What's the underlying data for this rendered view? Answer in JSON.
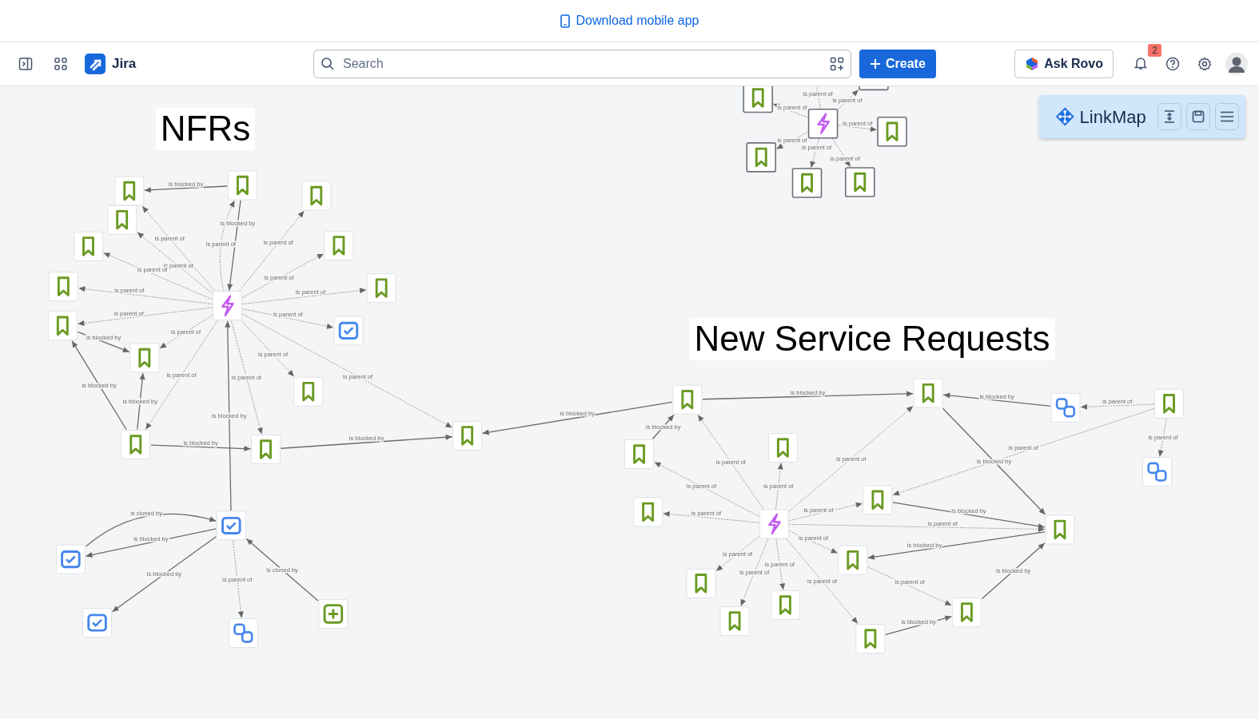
{
  "banner": {
    "text": "Download mobile app"
  },
  "topnav": {
    "app_name": "Jira",
    "search": {
      "placeholder": "Search"
    },
    "create_button": "Create",
    "rovo_button": "Ask Rovo",
    "notifications": "2"
  },
  "linkmap": {
    "title": "LinkMap"
  },
  "groups": [
    {
      "title": "NFRs"
    },
    {
      "title": "New Service Requests"
    }
  ],
  "nodes": [
    {
      "kind": "epic",
      "selected": false
    },
    {
      "kind": "story",
      "selected": false
    },
    {
      "kind": "story",
      "selected": false
    },
    {
      "kind": "story",
      "selected": false
    },
    {
      "kind": "story",
      "selected": false
    },
    {
      "kind": "story",
      "selected": false
    },
    {
      "kind": "story",
      "selected": false
    },
    {
      "kind": "story",
      "selected": false
    },
    {
      "kind": "story",
      "selected": false
    },
    {
      "kind": "story",
      "selected": false
    },
    {
      "kind": "story",
      "selected": false
    },
    {
      "kind": "story",
      "selected": false
    },
    {
      "kind": "story",
      "selected": false
    },
    {
      "kind": "task",
      "selected": false
    },
    {
      "kind": "story",
      "selected": false
    },
    {
      "kind": "story",
      "selected": false
    },
    {
      "kind": "task",
      "selected": false
    },
    {
      "kind": "task",
      "selected": false
    },
    {
      "kind": "task",
      "selected": false
    },
    {
      "kind": "subtask",
      "selected": false
    },
    {
      "kind": "feature",
      "selected": false
    },
    {
      "kind": "epic",
      "selected": true
    },
    {
      "kind": "story",
      "selected": true
    },
    {
      "kind": "story",
      "selected": true
    },
    {
      "kind": "story",
      "selected": true
    },
    {
      "kind": "story",
      "selected": true
    },
    {
      "kind": "story",
      "selected": true
    },
    {
      "kind": "story",
      "selected": true
    },
    {
      "kind": "epic",
      "selected": false
    },
    {
      "kind": "story",
      "selected": false
    },
    {
      "kind": "story",
      "selected": false
    },
    {
      "kind": "story",
      "selected": false
    },
    {
      "kind": "story",
      "selected": false
    },
    {
      "kind": "story",
      "selected": false
    },
    {
      "kind": "story",
      "selected": false
    },
    {
      "kind": "story",
      "selected": false
    },
    {
      "kind": "story",
      "selected": false
    },
    {
      "kind": "story",
      "selected": false
    },
    {
      "kind": "story",
      "selected": false
    },
    {
      "kind": "story",
      "selected": false
    },
    {
      "kind": "story",
      "selected": false
    },
    {
      "kind": "story",
      "selected": false
    },
    {
      "kind": "subtask",
      "selected": false
    },
    {
      "kind": "story",
      "selected": false
    },
    {
      "kind": "subtask",
      "selected": false
    }
  ],
  "edges": [
    {
      "label": "is blocked by",
      "dashed": false
    },
    {
      "label": "is parent of",
      "dashed": true
    },
    {
      "label": "is blocked by",
      "dashed": false
    },
    {
      "label": "is parent of",
      "dashed": true
    },
    {
      "label": "is parent of",
      "dashed": true
    },
    {
      "label": "is parent of",
      "dashed": true
    },
    {
      "label": "is parent of",
      "dashed": true
    },
    {
      "label": "is parent of",
      "dashed": true
    },
    {
      "label": "is parent of",
      "dashed": true
    },
    {
      "label": "is parent of",
      "dashed": true
    },
    {
      "label": "is parent of",
      "dashed": true
    },
    {
      "label": "is parent of",
      "dashed": true
    },
    {
      "label": "is parent of",
      "dashed": true
    },
    {
      "label": "is parent of",
      "dashed": true
    },
    {
      "label": "is parent of",
      "dashed": true
    },
    {
      "label": "is parent of",
      "dashed": true
    },
    {
      "label": "is parent of",
      "dashed": true
    },
    {
      "label": "is blocked by",
      "dashed": false
    },
    {
      "label": "is blocked by",
      "dashed": false
    },
    {
      "label": "is blocked by",
      "dashed": false
    },
    {
      "label": "is blocked by",
      "dashed": false
    },
    {
      "label": "is blocked by",
      "dashed": false
    },
    {
      "label": "is blocked by",
      "dashed": false
    },
    {
      "label": "is blocked by",
      "dashed": false
    },
    {
      "label": "is cloned by",
      "dashed": false
    },
    {
      "label": "is blocked by",
      "dashed": false
    },
    {
      "label": "is blocked by",
      "dashed": false
    },
    {
      "label": "is parent of",
      "dashed": true
    },
    {
      "label": "is cloned by",
      "dashed": false
    },
    {
      "label": "is parent of",
      "dashed": true
    },
    {
      "label": "is parent of",
      "dashed": true
    },
    {
      "label": "is parent of",
      "dashed": true
    },
    {
      "label": "is parent of",
      "dashed": true
    },
    {
      "label": "is parent of",
      "dashed": true
    },
    {
      "label": "is parent of",
      "dashed": true
    },
    {
      "label": "is parent of",
      "dashed": true
    },
    {
      "label": "is parent of",
      "dashed": true
    },
    {
      "label": "is parent of",
      "dashed": true
    },
    {
      "label": "is parent of",
      "dashed": true
    },
    {
      "label": "is parent of",
      "dashed": true
    },
    {
      "label": "is parent of",
      "dashed": true
    },
    {
      "label": "is parent of",
      "dashed": true
    },
    {
      "label": "is parent of",
      "dashed": true
    },
    {
      "label": "is parent of",
      "dashed": true
    },
    {
      "label": "is parent of",
      "dashed": true
    },
    {
      "label": "is parent of",
      "dashed": true
    },
    {
      "label": "is parent of",
      "dashed": true
    },
    {
      "label": "is parent of",
      "dashed": true
    },
    {
      "label": "is blocked by",
      "dashed": false
    },
    {
      "label": "is blocked by",
      "dashed": false
    },
    {
      "label": "is blocked by",
      "dashed": false
    },
    {
      "label": "is parent of",
      "dashed": true
    },
    {
      "label": "is parent of",
      "dashed": true
    },
    {
      "label": "is parent of",
      "dashed": true
    },
    {
      "label": "is blocked by",
      "dashed": false
    },
    {
      "label": "is blocked by",
      "dashed": false
    },
    {
      "label": "is blocked by",
      "dashed": false
    },
    {
      "label": "is parent of",
      "dashed": true
    },
    {
      "label": "is blocked by",
      "dashed": false
    },
    {
      "label": "is blocked by",
      "dashed": false
    }
  ]
}
